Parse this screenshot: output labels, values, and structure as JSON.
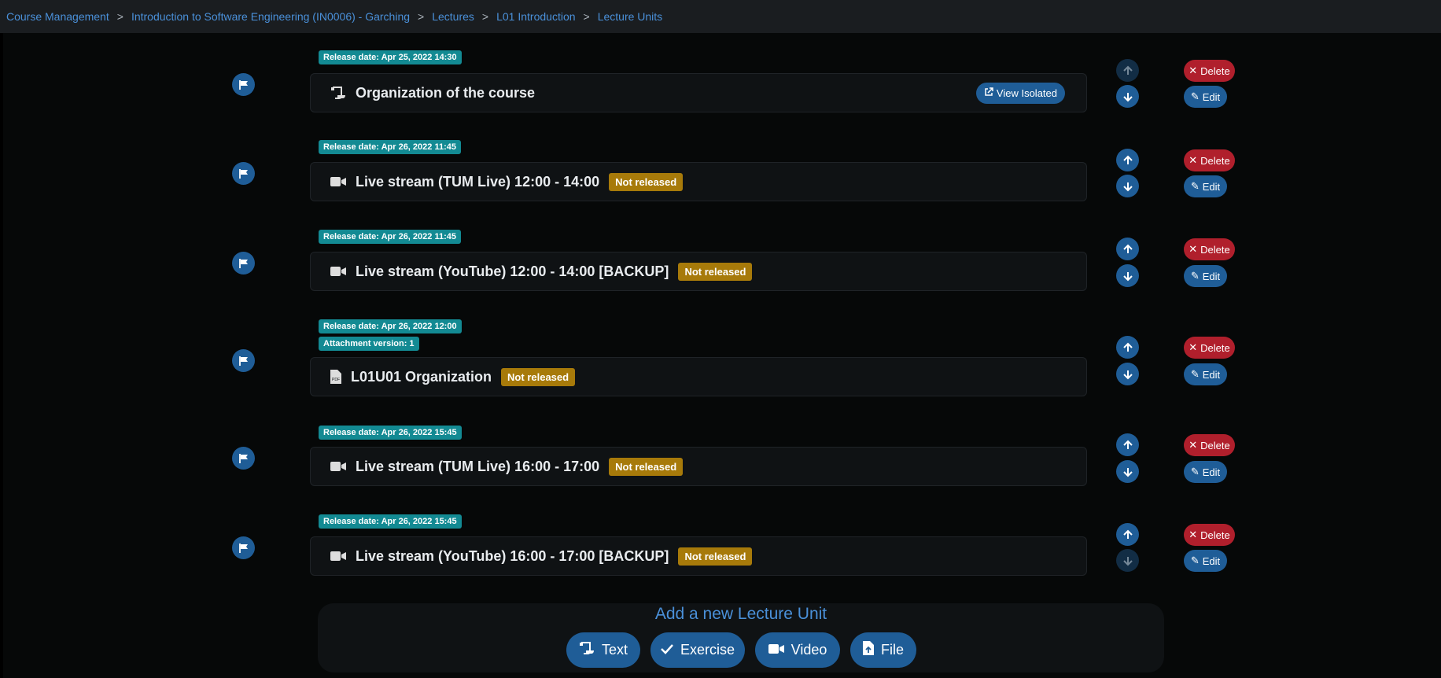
{
  "breadcrumb": {
    "items": [
      "Course Management",
      "Introduction to Software Engineering (IN0006) - Garching",
      "Lectures",
      "L01 Introduction",
      "Lecture Units"
    ],
    "separator": ">"
  },
  "units": [
    {
      "badges": [
        "Release date: Apr 25, 2022 14:30"
      ],
      "icon": "scroll-icon",
      "title": "Organization of the course",
      "not_released": "",
      "view_isolated": "View Isolated"
    },
    {
      "badges": [
        "Release date: Apr 26, 2022 11:45"
      ],
      "icon": "video-camera-icon",
      "title": "Live stream (TUM Live) 12:00 - 14:00",
      "not_released": "Not released"
    },
    {
      "badges": [
        "Release date: Apr 26, 2022 11:45"
      ],
      "icon": "video-camera-icon",
      "title": "Live stream (YouTube) 12:00 - 14:00 [BACKUP]",
      "not_released": "Not released"
    },
    {
      "badges": [
        "Release date: Apr 26, 2022 12:00",
        "Attachment version: 1"
      ],
      "icon": "pdf-file-icon",
      "title": "L01U01 Organization",
      "not_released": "Not released"
    },
    {
      "badges": [
        "Release date: Apr 26, 2022 15:45"
      ],
      "icon": "video-camera-icon",
      "title": "Live stream (TUM Live) 16:00 - 17:00",
      "not_released": "Not released"
    },
    {
      "badges": [
        "Release date: Apr 26, 2022 15:45"
      ],
      "icon": "video-camera-icon",
      "title": "Live stream (YouTube) 16:00 - 17:00 [BACKUP]",
      "not_released": "Not released"
    }
  ],
  "actions": {
    "delete": "Delete",
    "edit": "Edit"
  },
  "add_unit": {
    "title": "Add a new Lecture Unit",
    "buttons": [
      {
        "label": "Text",
        "icon": "scroll-icon"
      },
      {
        "label": "Exercise",
        "icon": "check-icon"
      },
      {
        "label": "Video",
        "icon": "video-camera-icon"
      },
      {
        "label": "File",
        "icon": "file-upload-icon"
      }
    ]
  },
  "colors": {
    "primary": "#1f5d97",
    "danger": "#b01f2c",
    "info_badge": "#138a93",
    "warning_badge": "#a77a0a",
    "link": "#4a90d9"
  }
}
